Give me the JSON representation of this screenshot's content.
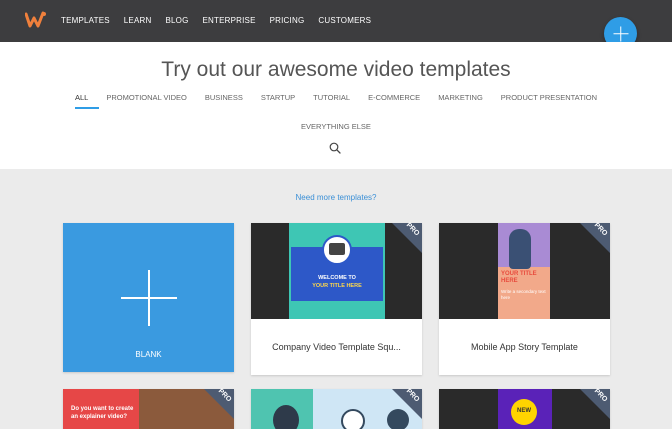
{
  "nav": {
    "items": [
      "TEMPLATES",
      "LEARN",
      "BLOG",
      "ENTERPRISE",
      "PRICING",
      "CUSTOMERS"
    ]
  },
  "hero": {
    "title": "Try out our awesome video templates",
    "categories": [
      "ALL",
      "PROMOTIONAL VIDEO",
      "BUSINESS",
      "STARTUP",
      "TUTORIAL",
      "E-COMMERCE",
      "MARKETING",
      "PRODUCT PRESENTATION"
    ],
    "categories_row2": [
      "EVERYTHING ELSE"
    ],
    "need_more": "Need more templates?"
  },
  "cards": [
    {
      "label": "BLANK"
    },
    {
      "caption": "Company Video Template Squ...",
      "badge": "PRO",
      "thumb_title": "WELCOME TO",
      "thumb_subtitle": "YOUR TITLE HERE"
    },
    {
      "caption": "Mobile App Story Template",
      "badge": "PRO",
      "thumb_title": "YOUR TITLE HERE",
      "thumb_subtitle": "Write a secondary text here"
    },
    {
      "badge": "PRO",
      "thumb_text": "Do you want to create an explainer video?"
    },
    {
      "badge": "PRO"
    },
    {
      "badge": "PRO",
      "thumb_text": "NEW"
    }
  ],
  "colors": {
    "accent": "#2f9de6",
    "topbar": "#3d3d3f",
    "brand": "#f0803c"
  }
}
